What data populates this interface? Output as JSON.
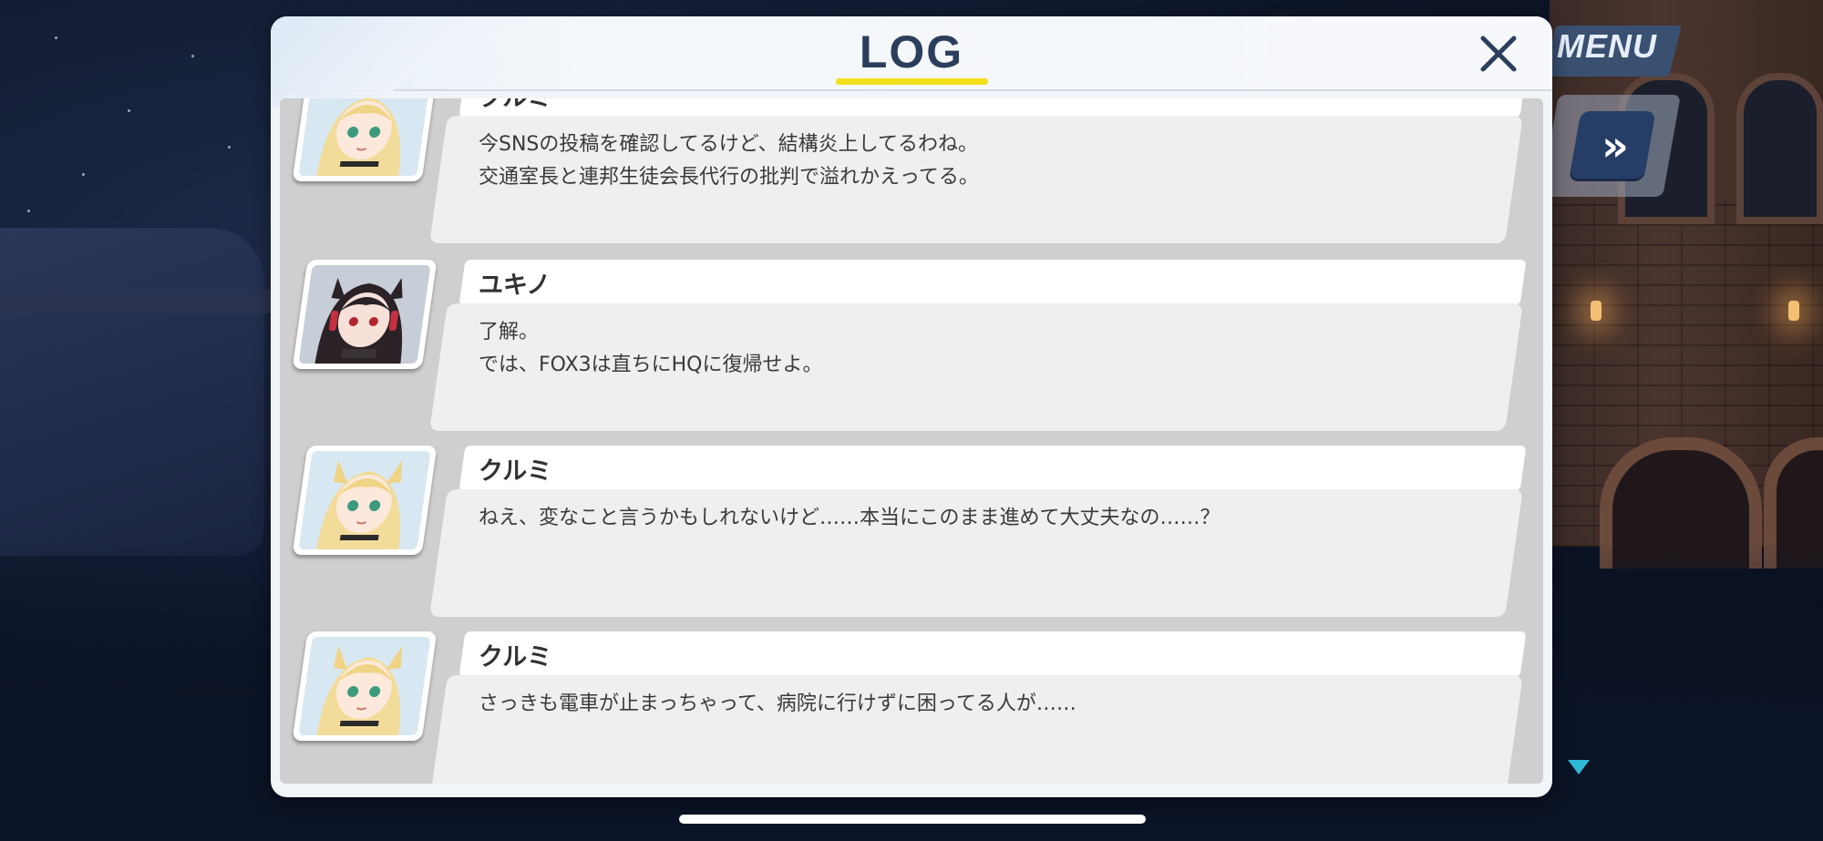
{
  "header": {
    "title": "LOG",
    "close_icon": "close-x-icon"
  },
  "hud": {
    "menu_label": "MENU",
    "skip_icon": "fast-forward-icon",
    "skip_glyph": "»",
    "next_icon": "triangle-down-icon"
  },
  "log": {
    "entries": [
      {
        "name": "クルミ",
        "avatar": "kurumi-portrait",
        "text": "今SNSの投稿を確認してるけど、結構炎上してるわね。\n交通室長と連邦生徒会長代行の批判で溢れかえってる。"
      },
      {
        "name": "ユキノ",
        "avatar": "yukino-portrait",
        "text": "了解。\nでは、FOX3は直ちにHQに復帰せよ。"
      },
      {
        "name": "クルミ",
        "avatar": "kurumi-portrait",
        "text": "ねえ、変なこと言うかもしれないけど……本当にこのまま進めて大丈夫なの……？"
      },
      {
        "name": "クルミ",
        "avatar": "kurumi-portrait",
        "text": "さっきも電車が止まっちゃって、病院に行けずに困ってる人が……"
      }
    ]
  },
  "colors": {
    "title": "#2b3e5c",
    "underline": "#f3e01c",
    "name_text": "#323232",
    "message_text": "#3a3a3a",
    "menu_button": "#3a5070",
    "skip_button": "#263e66"
  }
}
